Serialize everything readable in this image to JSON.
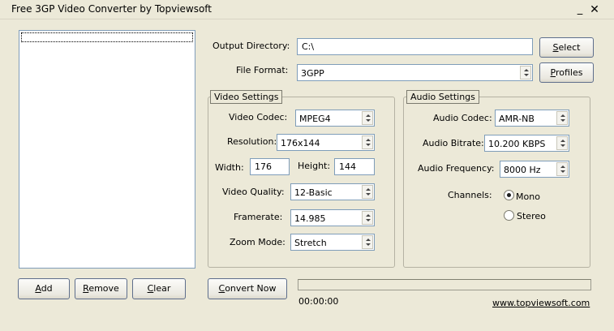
{
  "window": {
    "title": "Free 3GP Video Converter by Topviewsoft",
    "minimize_glyph": "_",
    "close_glyph": "✕"
  },
  "output": {
    "directory_label": "Output Directory:",
    "directory_value": "C:\\",
    "select_label": "Select",
    "file_format_label": "File Format:",
    "file_format_value": "3GPP",
    "profiles_label": "Profiles"
  },
  "video_settings": {
    "title": "Video Settings",
    "codec_label": "Video Codec:",
    "codec_value": "MPEG4",
    "resolution_label": "Resolution:",
    "resolution_value": "176x144",
    "width_label": "Width:",
    "width_value": "176",
    "height_label": "Height:",
    "height_value": "144",
    "quality_label": "Video Quality:",
    "quality_value": "12-Basic",
    "framerate_label": "Framerate:",
    "framerate_value": "14.985",
    "zoom_label": "Zoom Mode:",
    "zoom_value": "Stretch"
  },
  "audio_settings": {
    "title": "Audio Settings",
    "codec_label": "Audio Codec:",
    "codec_value": "AMR-NB",
    "bitrate_label": "Audio Bitrate:",
    "bitrate_value": "10.200 KBPS",
    "frequency_label": "Audio Frequency:",
    "frequency_value": "8000 Hz",
    "channels_label": "Channels:",
    "channels": [
      {
        "label": "Mono",
        "checked": true
      },
      {
        "label": "Stereo",
        "checked": false
      }
    ]
  },
  "file_list": {
    "add_label": "Add",
    "remove_label": "Remove",
    "clear_label": "Clear"
  },
  "conversion": {
    "convert_label": "Convert Now",
    "progress": 0,
    "elapsed_time": "00:00:00",
    "website": "www.topviewsoft.com"
  }
}
